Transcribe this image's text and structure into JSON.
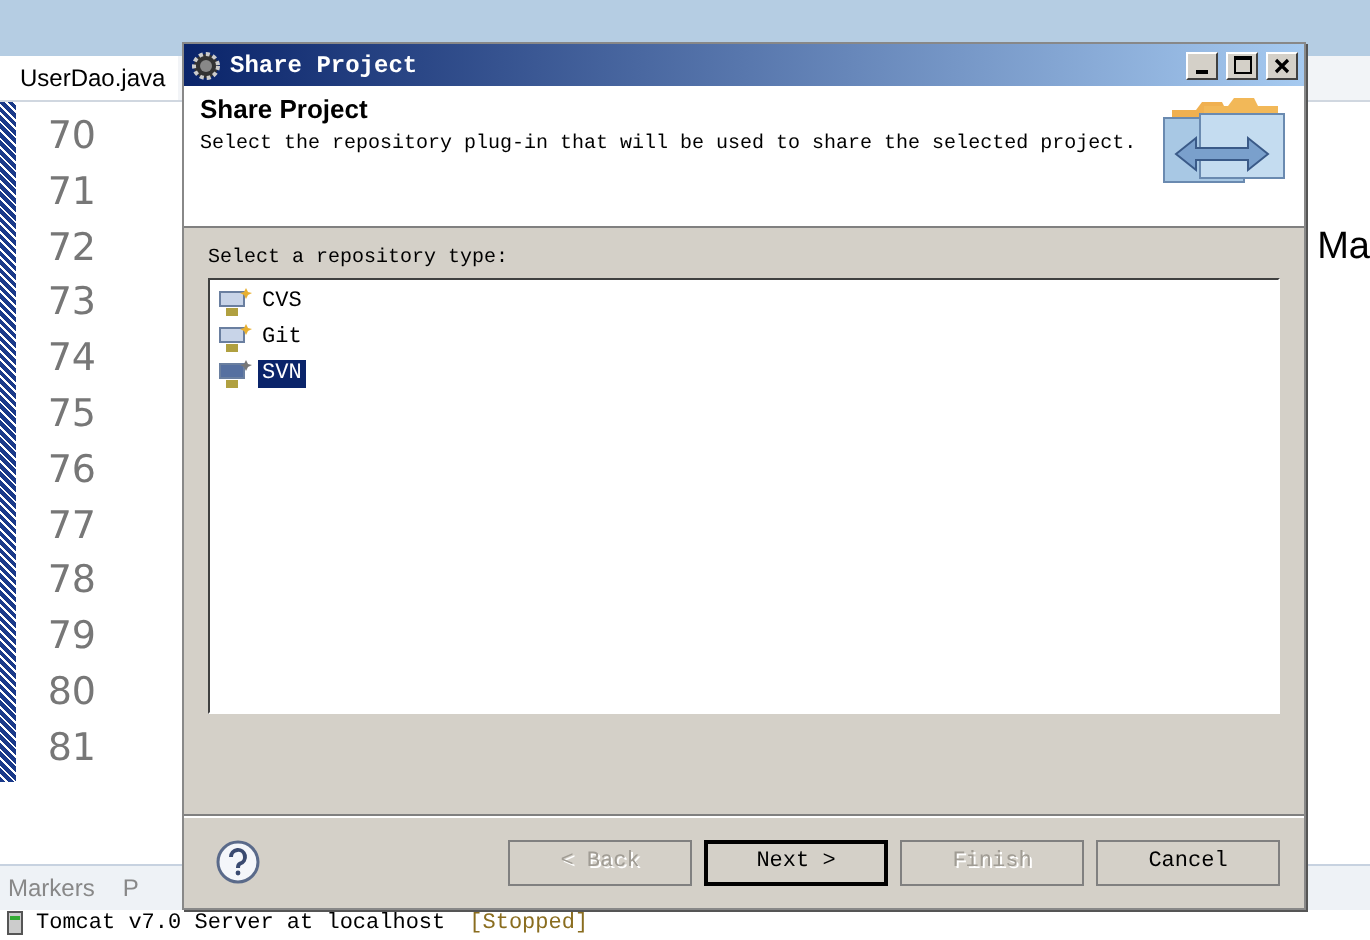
{
  "editor": {
    "tab": {
      "label": "UserDao.java"
    },
    "line_numbers": [
      "70",
      "71",
      "72",
      "73",
      "74",
      "75",
      "76",
      "77",
      "78",
      "79",
      "80",
      "81"
    ],
    "code_fragment": "Ma"
  },
  "bottom_panel": {
    "tabs": [
      {
        "label": "Markers"
      },
      {
        "label": "P"
      }
    ],
    "server": {
      "name": "Tomcat v7.0 Server at localhost",
      "status": "[Stopped]"
    }
  },
  "dialog": {
    "title": "Share Project",
    "heading": "Share Project",
    "description": "Select the repository plug-in that will be used to share the selected project.",
    "list_label": "Select a repository type:",
    "repositories": [
      {
        "label": "CVS",
        "selected": false
      },
      {
        "label": "Git",
        "selected": false
      },
      {
        "label": "SVN",
        "selected": true
      }
    ],
    "buttons": [
      {
        "label": "< Back",
        "disabled": true,
        "default": false
      },
      {
        "label": "Next >",
        "disabled": false,
        "default": true
      },
      {
        "label": "Finish",
        "disabled": true,
        "default": false
      },
      {
        "label": "Cancel",
        "disabled": false,
        "default": false
      }
    ]
  }
}
